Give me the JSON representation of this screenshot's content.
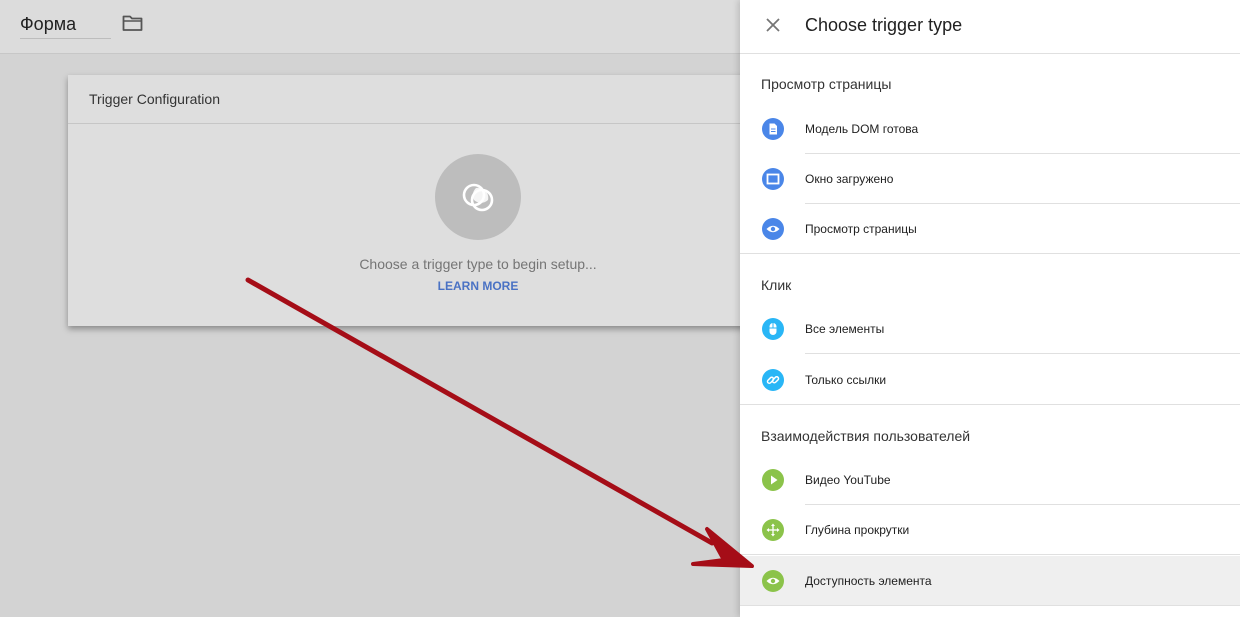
{
  "workspace": {
    "name": "Форма"
  },
  "card": {
    "header": "Trigger Configuration",
    "hint": "Choose a trigger type to begin setup...",
    "learn_more": "LEARN MORE"
  },
  "panel": {
    "title": "Choose trigger type",
    "sections": [
      {
        "title": "Просмотр страницы",
        "items": [
          {
            "label": "Модель DOM готова",
            "icon": "document-icon",
            "color": "#4a86e8"
          },
          {
            "label": "Окно загружено",
            "icon": "window-icon",
            "color": "#4a86e8"
          },
          {
            "label": "Просмотр страницы",
            "icon": "eye-icon",
            "color": "#4a86e8"
          }
        ]
      },
      {
        "title": "Клик",
        "items": [
          {
            "label": "Все элементы",
            "icon": "mouse-icon",
            "color": "#29b6f6"
          },
          {
            "label": "Только ссылки",
            "icon": "link-icon",
            "color": "#29b6f6"
          }
        ]
      },
      {
        "title": "Взаимодействия пользователей",
        "items": [
          {
            "label": "Видео YouTube",
            "icon": "play-icon",
            "color": "#8bc34a"
          },
          {
            "label": "Глубина прокрутки",
            "icon": "move-icon",
            "color": "#8bc34a"
          },
          {
            "label": "Доступность элемента",
            "icon": "eye-icon",
            "color": "#8bc34a",
            "highlighted": true
          }
        ]
      }
    ]
  },
  "colors": {
    "accent_link": "#4a72c4",
    "annotation_arrow": "#a50d17"
  }
}
